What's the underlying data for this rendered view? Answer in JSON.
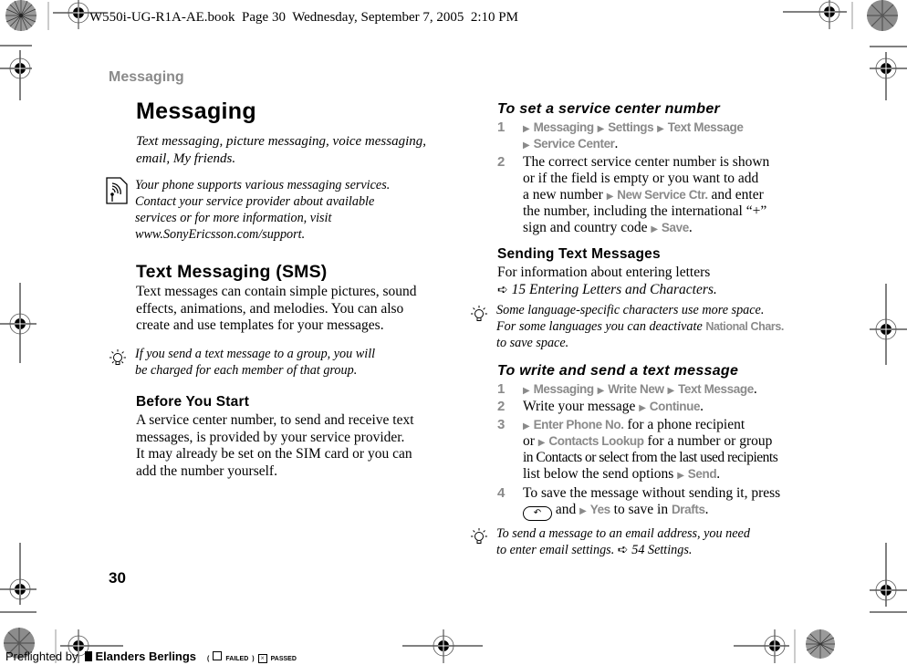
{
  "print_header": {
    "slug": "W550i-UG-R1A-AE.book  Page 30  Wednesday, September 7, 2005  2:10 PM"
  },
  "running_head": "Messaging",
  "page_number": "30",
  "left_column": {
    "title": "Messaging",
    "intro": "Text messaging, picture messaging, voice messaging, email, My friends.",
    "intro_lines": [
      "Text messaging, picture messaging, voice messaging,",
      "email, My friends."
    ],
    "operator_note": {
      "icon": "network-services-icon",
      "lines": [
        "Your phone supports various messaging services.",
        "Contact your service provider about available",
        "services or for more information, visit",
        "www.SonyEricsson.com/support."
      ]
    },
    "sms_heading": "Text Messaging (SMS)",
    "sms_body_lines": [
      "Text messages can contain simple pictures, sound",
      "effects, animations, and melodies. You can also",
      "create and use templates for your messages."
    ],
    "group_tip": {
      "icon": "lightbulb-tip-icon",
      "lines": [
        "If you send a text message to a group, you will",
        "be charged for each member of that group."
      ]
    },
    "before_heading": "Before You Start",
    "before_body_lines": [
      "A service center number, to send and receive text",
      "messages, is provided by your service provider.",
      "It may already be set on the SIM card or you can",
      "add the number yourself."
    ]
  },
  "right_column": {
    "service_center": {
      "heading": "To set a service center number",
      "step1": {
        "num": "1",
        "menu": [
          "Messaging",
          "Settings",
          "Text Message",
          "Service Center"
        ]
      },
      "step2": {
        "num": "2",
        "line1": "The correct service center number is shown",
        "line2": "or if the field is empty or you want to add",
        "line3_pre": "a new number",
        "line3_menu": "New Service Ctr.",
        "line3_post": "and enter",
        "line4": "the number, including the international “+”",
        "line5_pre": "sign and country code",
        "line5_menu": "Save"
      }
    },
    "sending": {
      "heading": "Sending Text Messages",
      "line1": "For information about entering letters",
      "ref": "15 Entering Letters and Characters",
      "tip": {
        "line1": "Some language-specific characters use more space.",
        "line2_pre": "For some languages you can deactivate",
        "line2_menu": "National Chars.",
        "line3": "to save space."
      }
    },
    "write_send": {
      "heading": "To write and send a text message",
      "step1": {
        "num": "1",
        "menu": [
          "Messaging",
          "Write New",
          "Text Message"
        ]
      },
      "step2": {
        "num": "2",
        "pre": "Write your message",
        "menu": "Continue"
      },
      "step3": {
        "num": "3",
        "l1_menu": "Enter Phone No.",
        "l1_post": "for a phone recipient",
        "l2_pre": "or",
        "l2_menu": "Contacts Lookup",
        "l2_post": "for a number or group",
        "l3": "in Contacts or select from the last used recipients",
        "l4_pre": "list below the send options",
        "l4_menu": "Send"
      },
      "step4": {
        "num": "4",
        "l1": "To save the message without sending it, press",
        "l2_key": "back-key",
        "l2_and": "and",
        "l2_menu": "Yes",
        "l2_mid": "to save in",
        "l2_menu2": "Drafts"
      }
    },
    "email_tip": {
      "line1": "To send a message to an email address, you need",
      "line2_pre": "to enter email settings.",
      "ref": "54 Settings"
    }
  },
  "preflight_footer": {
    "prefix": "Preflighted by",
    "brand": "Elanders Berlings",
    "failed": "FAILED",
    "passed": "PASSED",
    "failed_checked": false,
    "passed_checked": true
  },
  "colors": {
    "menu_gray": "#8a8a8a",
    "text": "#000000"
  }
}
